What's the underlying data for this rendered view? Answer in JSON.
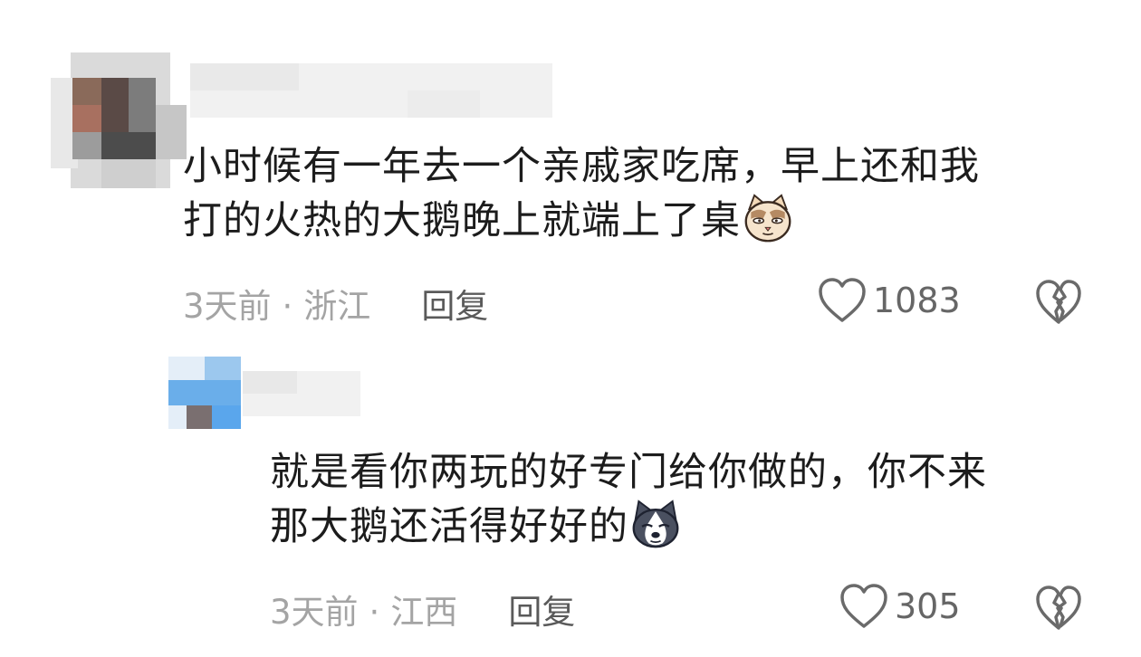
{
  "comments": [
    {
      "text_lines": [
        "小时候有一年去一个亲戚家吃席，早上还和我",
        "打的火热的大鹅晚上就端上了桌"
      ],
      "emoji": "cat-face-emoji",
      "time": "3天前",
      "separator": "·",
      "location": "浙江",
      "reply_label": "回复",
      "like_count": "1083"
    },
    {
      "text_lines": [
        "就是看你两玩的好专门给你做的，你不来",
        "那大鹅还活得好好的"
      ],
      "emoji": "husky-dog-emoji",
      "time": "3天前",
      "separator": "·",
      "location": "江西",
      "reply_label": "回复",
      "like_count": "305"
    }
  ],
  "icons": {
    "like": "heart-outline-icon",
    "dislike": "broken-heart-icon",
    "avatar": "blurred-avatar"
  },
  "colors": {
    "text": "#1c1c1c",
    "meta": "#a4a4a4",
    "reply": "#5a5a5a",
    "icon": "#666666"
  }
}
